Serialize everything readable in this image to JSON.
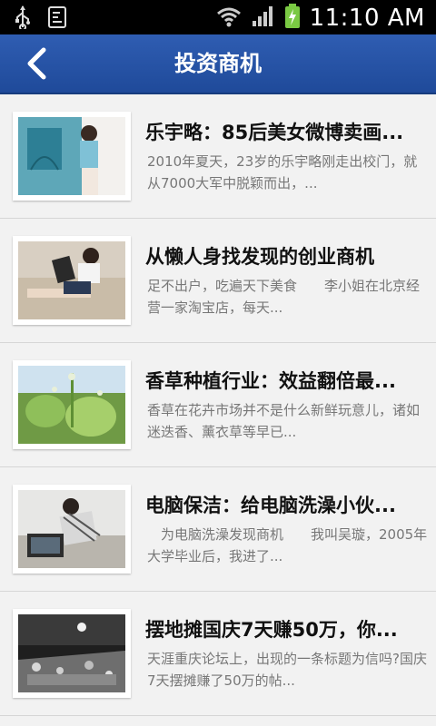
{
  "status_bar": {
    "time": "11:10 AM"
  },
  "header": {
    "title": "投资商机"
  },
  "articles": [
    {
      "title": "乐宇略：85后美女微博卖画...",
      "summary": "2010年夏天，23岁的乐宇略刚走出校门，就从7000大军中脱颖而出，..."
    },
    {
      "title": "从懒人身找发现的创业商机",
      "summary": "足不出户，吃遍天下美食　　李小姐在北京经营一家淘宝店，每天..."
    },
    {
      "title": "香草种植行业：效益翻倍最...",
      "summary": "香草在花卉市场并不是什么新鲜玩意儿，诸如迷迭香、薰衣草等早已..."
    },
    {
      "title": "电脑保洁：给电脑洗澡小伙...",
      "summary": "　为电脑洗澡发现商机　　我叫吴璇，2005年大学毕业后，我进了..."
    },
    {
      "title": "摆地摊国庆7天赚50万，你...",
      "summary": "天涯重庆论坛上，出现的一条标题为信吗?国庆7天摆摊赚了50万的帖..."
    }
  ]
}
